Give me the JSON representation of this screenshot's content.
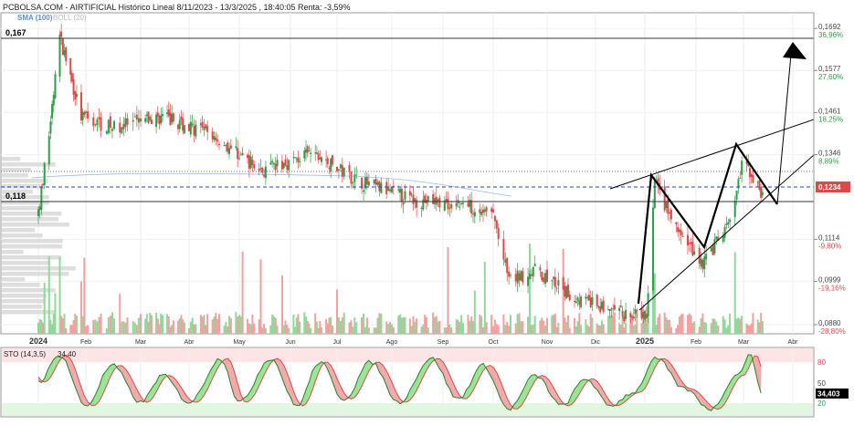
{
  "header": {
    "title": "PCBOLSA.COM - AIRTIFICIAL Histórico Lineal 8/11/2023 - 13/3/2025 , 18:40:05 Renta: -3,59%",
    "indicator_sma": "SMA (100)",
    "indicator_boll": "BOLL (20)"
  },
  "colors": {
    "up": "#2e9e4a",
    "down": "#e04848",
    "price_tag_bg": "#e04848",
    "sma": "#5b8fd6",
    "sto_fill_green": "#8fe08a",
    "sto_fill_red": "#f0a0a0",
    "sto_zone_top": "#fde5e5",
    "sto_zone_bottom": "#e2f7df"
  },
  "levels": {
    "resistance_label": "0,167",
    "support_label": "0,118",
    "current_price_tag": "0,1234"
  },
  "chart_data": [
    {
      "type": "candlestick",
      "title": "",
      "x_tick_labels": [
        "2024",
        "Feb",
        "Mar",
        "Abr",
        "May",
        "Jun",
        "Jul",
        "Ago",
        "Sep",
        "Oct",
        "Nov",
        "Dic",
        "2025",
        "Feb",
        "Mar",
        "Abr"
      ],
      "y_ticks": [
        {
          "value": 0.1692,
          "label": "0,1692",
          "pct": "36,96%"
        },
        {
          "value": 0.1577,
          "label": "0,1577",
          "pct": "27,60%"
        },
        {
          "value": 0.1461,
          "label": "0,1461",
          "pct": "18,25%"
        },
        {
          "value": 0.1346,
          "label": "0,1346",
          "pct": "8,89%"
        },
        {
          "value": 0.1114,
          "label": "0,1114",
          "pct": "-9,80%"
        },
        {
          "value": 0.0999,
          "label": "0,0999",
          "pct": "-19,16%"
        },
        {
          "value": 0.088,
          "label": "0,0880",
          "pct": "-28,80%"
        }
      ],
      "ylim": [
        0.0855,
        0.1735
      ],
      "horizontal_levels": [
        0.167,
        0.118
      ],
      "current_price": 0.1234,
      "approx_close_path": [
        {
          "x": "2024-01-01",
          "y": 0.118
        },
        {
          "x": "2024-01-08",
          "y": 0.14
        },
        {
          "x": "2024-01-15",
          "y": 0.167
        },
        {
          "x": "2024-01-29",
          "y": 0.145
        },
        {
          "x": "2024-02-15",
          "y": 0.142
        },
        {
          "x": "2024-03-15",
          "y": 0.145
        },
        {
          "x": "2024-04-15",
          "y": 0.14
        },
        {
          "x": "2024-05-15",
          "y": 0.13
        },
        {
          "x": "2024-06-15",
          "y": 0.135
        },
        {
          "x": "2024-07-15",
          "y": 0.127
        },
        {
          "x": "2024-08-15",
          "y": 0.122
        },
        {
          "x": "2024-09-15",
          "y": 0.121
        },
        {
          "x": "2024-10-01",
          "y": 0.118
        },
        {
          "x": "2024-10-10",
          "y": 0.1
        },
        {
          "x": "2024-10-25",
          "y": 0.103
        },
        {
          "x": "2024-11-15",
          "y": 0.096
        },
        {
          "x": "2024-12-15",
          "y": 0.091
        },
        {
          "x": "2025-01-02",
          "y": 0.09
        },
        {
          "x": "2025-01-07",
          "y": 0.127
        },
        {
          "x": "2025-01-20",
          "y": 0.114
        },
        {
          "x": "2025-02-05",
          "y": 0.105
        },
        {
          "x": "2025-02-20",
          "y": 0.115
        },
        {
          "x": "2025-03-01",
          "y": 0.133
        },
        {
          "x": "2025-03-13",
          "y": 0.1234
        }
      ]
    },
    {
      "type": "line",
      "title": "",
      "label": "STO (14,3,5)",
      "value_label": "34,40",
      "current_value_tag": "34,403",
      "y_ticks": [
        80,
        50,
        20
      ],
      "ylim": [
        0,
        100
      ],
      "approx_path": [
        {
          "x": "2024-01-01",
          "y": 50
        },
        {
          "x": "2024-01-15",
          "y": 90
        },
        {
          "x": "2024-02-01",
          "y": 15
        },
        {
          "x": "2024-02-15",
          "y": 75
        },
        {
          "x": "2024-03-01",
          "y": 20
        },
        {
          "x": "2024-03-15",
          "y": 60
        },
        {
          "x": "2024-04-01",
          "y": 20
        },
        {
          "x": "2024-04-20",
          "y": 85
        },
        {
          "x": "2024-05-01",
          "y": 20
        },
        {
          "x": "2024-05-20",
          "y": 85
        },
        {
          "x": "2024-06-05",
          "y": 15
        },
        {
          "x": "2024-06-20",
          "y": 80
        },
        {
          "x": "2024-07-05",
          "y": 25
        },
        {
          "x": "2024-07-20",
          "y": 80
        },
        {
          "x": "2024-08-05",
          "y": 20
        },
        {
          "x": "2024-08-25",
          "y": 85
        },
        {
          "x": "2024-09-10",
          "y": 25
        },
        {
          "x": "2024-09-25",
          "y": 75
        },
        {
          "x": "2024-10-10",
          "y": 10
        },
        {
          "x": "2024-10-25",
          "y": 60
        },
        {
          "x": "2024-11-10",
          "y": 15
        },
        {
          "x": "2024-11-25",
          "y": 55
        },
        {
          "x": "2024-12-10",
          "y": 15
        },
        {
          "x": "2024-12-25",
          "y": 35
        },
        {
          "x": "2025-01-08",
          "y": 85
        },
        {
          "x": "2025-01-25",
          "y": 40
        },
        {
          "x": "2025-02-10",
          "y": 10
        },
        {
          "x": "2025-02-25",
          "y": 60
        },
        {
          "x": "2025-03-05",
          "y": 90
        },
        {
          "x": "2025-03-13",
          "y": 34.4
        }
      ]
    }
  ]
}
